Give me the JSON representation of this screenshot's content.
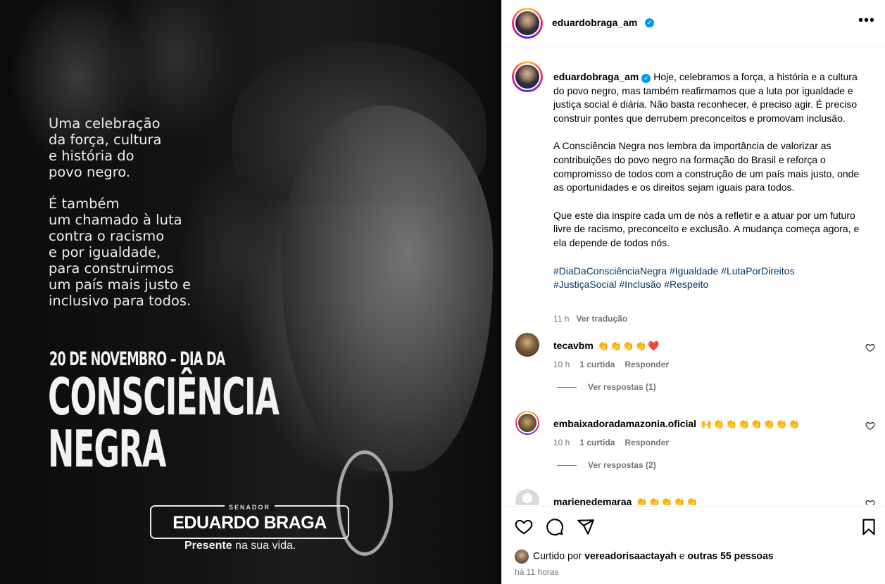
{
  "post_image": {
    "text_block_1": [
      "Uma celebração",
      "da força, cultura",
      "e história do",
      "povo negro."
    ],
    "text_block_2": [
      "É também",
      "um chamado à luta",
      "contra o racismo",
      "e por igualdade,",
      "para construirmos",
      "um país mais justo e",
      "inclusivo para todos."
    ],
    "date_line": "20 DE NOVEMBRO – DIA DA",
    "big_word_1": "CONSCIÊNCIA",
    "big_word_2": "NEGRA",
    "senador_label": "SENADOR",
    "senador_name": "EDUARDO BRAGA",
    "slogan_bold": "Presente",
    "slogan_rest": " na sua vida."
  },
  "header": {
    "username": "eduardobraga_am",
    "verified_icon": "verified-badge-icon",
    "more_icon": "more-options-icon"
  },
  "caption": {
    "username": "eduardobraga_am",
    "paragraph_1": "Hoje, celebramos a força, a história e a cultura do povo negro, mas também reafirmamos que a luta por igualdade e justiça social é diária. Não basta reconhecer, é preciso agir. É preciso construir pontes que derrubem preconceitos e promovam inclusão.",
    "paragraph_2": "A Consciência Negra nos lembra da importância de valorizar as contribuições do povo negro na formação do Brasil e reforça o compromisso de todos com a construção de um país mais justo, onde as oportunidades e os direitos sejam iguais para todos.",
    "paragraph_3": "Que este dia inspire cada um de nós a refletir e a atuar por um futuro livre de racismo, preconceito e exclusão. A mudança começa agora, e ela depende de todos nós.",
    "hashtags": [
      "#DiaDaConsciênciaNegra",
      "#Igualdade",
      "#LutaPorDireitos",
      "#JustiçaSocial",
      "#Inclusão",
      "#Respeito"
    ],
    "time": "11 h",
    "see_translation": "Ver tradução"
  },
  "comments": [
    {
      "username": "tecavbm",
      "text": "👏 👏 👏 👏 ❤️",
      "time": "10 h",
      "likes": "1 curtida",
      "reply": "Responder",
      "replies": "Ver respostas (1)"
    },
    {
      "username": "embaixadoradamazonia.oficial",
      "text": "🙌 👏 👏 👏 👏 👏 👏 👏",
      "time": "10 h",
      "likes": "1 curtida",
      "reply": "Responder",
      "replies": "Ver respostas (2)"
    },
    {
      "username": "marienedemaraa",
      "text": "👏 👏 👏 👏 👏"
    }
  ],
  "footer": {
    "liked_prefix": "Curtido por ",
    "liked_user": "vereadorisaactayah",
    "liked_connector": " e ",
    "liked_others": "outras 55 pessoas",
    "time": "há 11 horas"
  }
}
